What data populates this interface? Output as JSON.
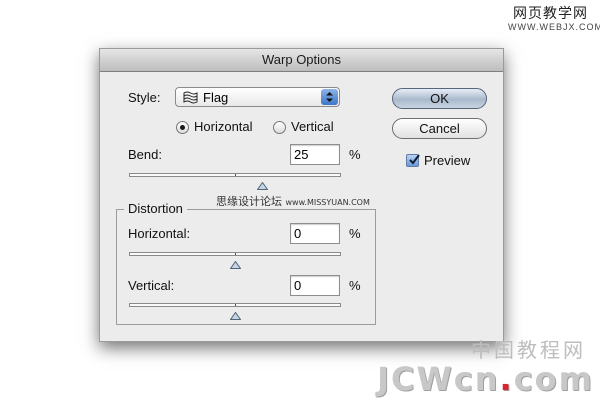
{
  "dialog": {
    "title": "Warp Options"
  },
  "style": {
    "label": "Style:",
    "selected": "Flag",
    "icon": "flag-warp-icon"
  },
  "orientation": {
    "horizontal_label": "Horizontal",
    "vertical_label": "Vertical",
    "selected": "Horizontal"
  },
  "bend": {
    "label": "Bend:",
    "value": "25",
    "unit": "%",
    "slider_percent": 25
  },
  "distortion": {
    "group_label": "Distortion",
    "horizontal": {
      "label": "Horizontal:",
      "value": "0",
      "unit": "%",
      "slider_percent": 0
    },
    "vertical": {
      "label": "Vertical:",
      "value": "0",
      "unit": "%",
      "slider_percent": 0
    }
  },
  "buttons": {
    "ok_label": "OK",
    "cancel_label": "Cancel"
  },
  "preview": {
    "label": "Preview",
    "checked": true
  },
  "watermarks": {
    "top_cn": "网页教学网",
    "top_url": "WWW.WEBJX.COM",
    "mid_cn": "思缘设计论坛",
    "mid_url": "www.MISSYUAN.COM",
    "bottom_cn": "中国教程网",
    "bottom_en_a": "JCWcn",
    "bottom_en_dot": ".",
    "bottom_en_b": "com"
  },
  "colors": {
    "dialog_bg": "#ececec",
    "default_button": "#a9b9cc",
    "popup_arrows": "#3d76c8",
    "checkbox_blue": "#6a98d8",
    "watermark_red_dot": "#d8252f"
  }
}
